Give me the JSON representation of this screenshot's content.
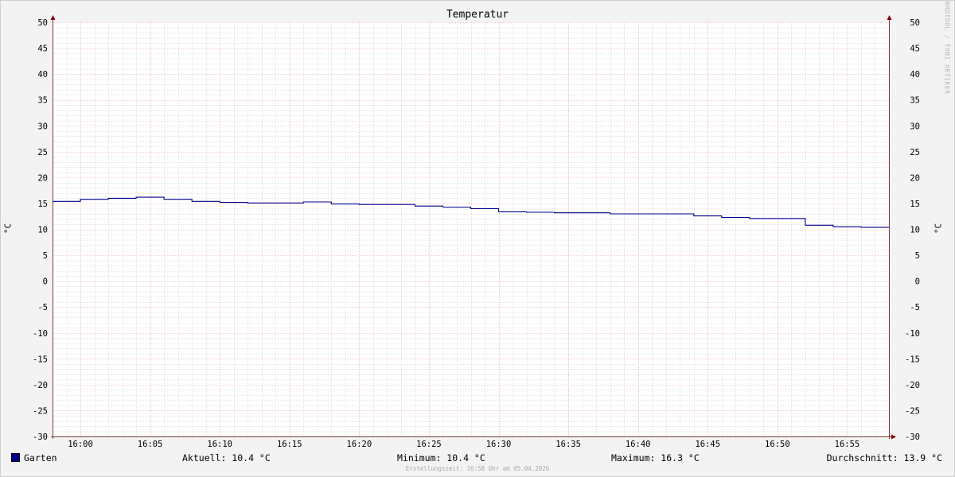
{
  "watermark": "RRDTOOL / TOBI OETIKER",
  "colors": {
    "series": "#00008b",
    "minor_grid": "#c8c8c8",
    "major_grid": "#e8a0a0",
    "axis": "#7a3a3a",
    "arrow": "#8b0000"
  },
  "legend": {
    "series_name": "Garten",
    "current": "Aktuell: 10.4 °C",
    "minimum": "Minimum: 10.4 °C",
    "maximum": "Maximum: 16.3 °C",
    "average": "Durchschnitt: 13.9 °C"
  },
  "footer": "Erstellungszeit: 16:58 Uhr am 05.04.2026",
  "chart_data": {
    "type": "line",
    "title": "Temperatur",
    "ylabel": "°C",
    "ylim": [
      -30,
      50
    ],
    "yticks": [
      50,
      45,
      40,
      35,
      30,
      25,
      20,
      15,
      10,
      5,
      0,
      -5,
      -10,
      -15,
      -20,
      -25,
      -30
    ],
    "xlim": [
      "15:58",
      "16:58"
    ],
    "xtick_labels": [
      "16:00",
      "16:05",
      "16:10",
      "16:15",
      "16:20",
      "16:25",
      "16:30",
      "16:35",
      "16:40",
      "16:45",
      "16:50",
      "16:55"
    ],
    "grid": true,
    "series": [
      {
        "name": "Garten",
        "step": true,
        "x": [
          "15:58",
          "16:00",
          "16:02",
          "16:04",
          "16:06",
          "16:08",
          "16:10",
          "16:12",
          "16:14",
          "16:16",
          "16:18",
          "16:20",
          "16:22",
          "16:24",
          "16:26",
          "16:28",
          "16:30",
          "16:32",
          "16:34",
          "16:36",
          "16:38",
          "16:40",
          "16:42",
          "16:44",
          "16:46",
          "16:48",
          "16:50",
          "16:52",
          "16:54",
          "16:56",
          "16:58"
        ],
        "values": [
          15.4,
          15.8,
          16.0,
          16.2,
          15.8,
          15.4,
          15.2,
          15.1,
          15.1,
          15.3,
          14.9,
          14.8,
          14.8,
          14.5,
          14.3,
          14.0,
          13.4,
          13.3,
          13.2,
          13.2,
          13.0,
          13.0,
          13.0,
          12.6,
          12.3,
          12.1,
          12.1,
          10.8,
          10.5,
          10.4,
          10.4
        ]
      }
    ]
  }
}
